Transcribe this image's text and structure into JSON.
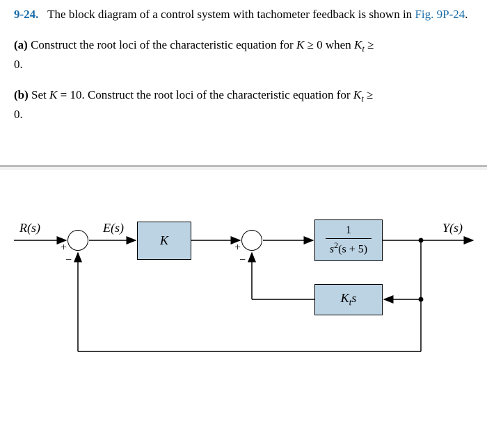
{
  "problem": {
    "number": "9-24.",
    "intro": "The block diagram of a control system with tachometer feedback is shown in ",
    "figref": "Fig. 9P-24",
    "period": "."
  },
  "parts": {
    "a": {
      "label": "(a)",
      "text_before": "Construct the root loci of the characteristic equation for ",
      "cond1_var": "K",
      "cond1_op": " ≥ 0 when ",
      "cond2_var": "K",
      "cond2_sub": "t",
      "cond2_op": " ≥",
      "tail": "0."
    },
    "b": {
      "label": "(b)",
      "text_before": "Set ",
      "set_var": "K",
      "set_val": " = 10. Construct the root loci of the characteristic equation for ",
      "cond_var": "K",
      "cond_sub": "t",
      "cond_op": " ≥",
      "tail": "0."
    }
  },
  "diagram": {
    "signals": {
      "R": "R(s)",
      "E": "E(s)",
      "Y": "Y(s)"
    },
    "blocks": {
      "gain": "K",
      "plant_num": "1",
      "plant_den_pre": "s",
      "plant_den_exp": "2",
      "plant_den_post": "(s + 5)",
      "tach_pre": "K",
      "tach_sub": "t",
      "tach_post": "s"
    },
    "signs": {
      "sum1_plus": "+",
      "sum1_minus": "−",
      "sum2_plus": "+",
      "sum2_minus": "−"
    }
  }
}
